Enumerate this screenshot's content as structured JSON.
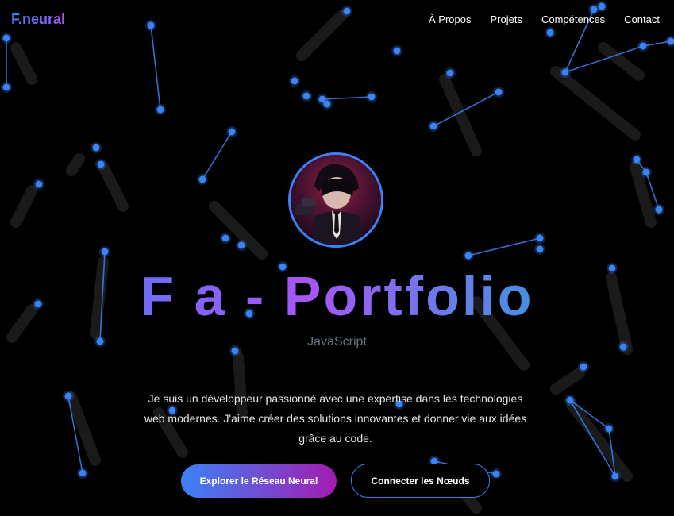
{
  "header": {
    "logo": "F.neural",
    "nav": [
      {
        "label": "À Propos"
      },
      {
        "label": "Projets"
      },
      {
        "label": "Compétences"
      },
      {
        "label": "Contact"
      }
    ]
  },
  "hero": {
    "title": "F a - Portfolio",
    "subtitle": "JavaScript",
    "description": "Je suis un développeur passionné avec une expertise dans les technologies web modernes. J'aime créer des solutions innovantes et donner vie aux idées grâce au code.",
    "primary_button": "Explorer le Réseau Neural",
    "secondary_button": "Connecter les Nœuds"
  },
  "colors": {
    "background": "#000000",
    "accent_blue": "#3b82f6",
    "accent_purple": "#a855f7",
    "accent_cyan": "#06b6d4",
    "node": "#3b82f6"
  }
}
